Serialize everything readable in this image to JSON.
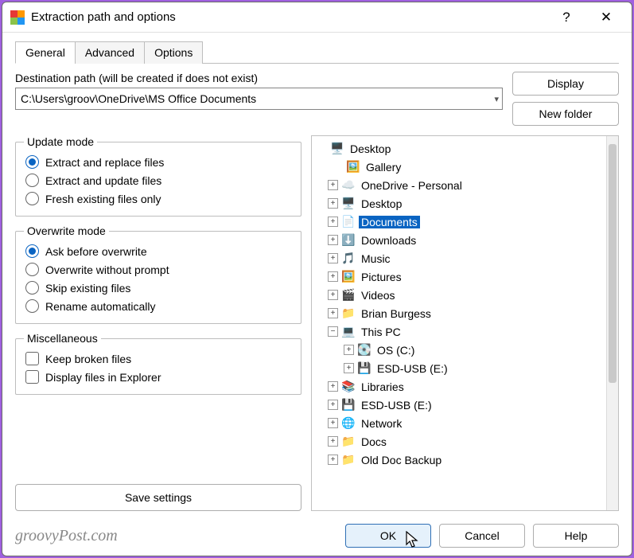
{
  "window": {
    "title": "Extraction path and options"
  },
  "tabs": {
    "general": "General",
    "advanced": "Advanced",
    "options": "Options"
  },
  "destination": {
    "label": "Destination path (will be created if does not exist)",
    "value": "C:\\Users\\groov\\OneDrive\\MS Office Documents"
  },
  "buttons": {
    "display": "Display",
    "new_folder": "New folder",
    "save_settings": "Save settings",
    "ok": "OK",
    "cancel": "Cancel",
    "help": "Help"
  },
  "groups": {
    "update": {
      "legend": "Update mode"
    },
    "overwrite": {
      "legend": "Overwrite mode"
    },
    "misc": {
      "legend": "Miscellaneous"
    }
  },
  "update": {
    "replace": "Extract and replace files",
    "update": "Extract and update files",
    "fresh": "Fresh existing files only"
  },
  "overwrite": {
    "ask": "Ask before overwrite",
    "noprompt": "Overwrite without prompt",
    "skip": "Skip existing files",
    "rename": "Rename automatically"
  },
  "misc": {
    "keep_broken": "Keep broken files",
    "show_explorer": "Display files in Explorer"
  },
  "tree": {
    "desktop": "Desktop",
    "gallery": "Gallery",
    "onedrive": "OneDrive - Personal",
    "desktop2": "Desktop",
    "documents": "Documents",
    "downloads": "Downloads",
    "music": "Music",
    "pictures": "Pictures",
    "videos": "Videos",
    "user": "Brian Burgess",
    "thispc": "This PC",
    "osc": "OS (C:)",
    "esdusb": "ESD-USB (E:)",
    "libraries": "Libraries",
    "esdusb2": "ESD-USB (E:)",
    "network": "Network",
    "docs": "Docs",
    "oldbackup": "Old Doc Backup"
  },
  "watermark": "groovyPost.com"
}
